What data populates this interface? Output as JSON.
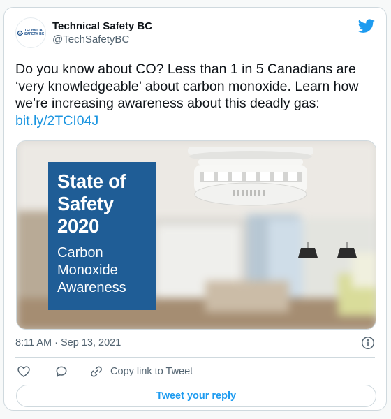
{
  "tweet": {
    "author_name": "Technical Safety BC",
    "author_handle": "@TechSafetyBC",
    "avatar_logo_text": [
      "TECHNICAL",
      "SAFETY BC"
    ],
    "text_lines": [
      "Do you know about CO? Less than 1 in 5 Canadians are",
      "‘very knowledgeable’ about carbon monoxide. Learn how",
      "we’re increasing awareness about this deadly gas:"
    ],
    "link_text": "bit.ly/2TCI04J",
    "timestamp": "8:11 AM · Sep 13, 2021"
  },
  "media": {
    "overlay_title_lines": [
      "State of",
      "Safety",
      "2020"
    ],
    "overlay_subtitle_lines": [
      "Carbon",
      "Monoxide",
      "Awareness"
    ],
    "overlay_color": "#1f5d96",
    "illustration": "smoke-detector-on-ceiling"
  },
  "actions": {
    "like_icon": "heart-icon",
    "reply_icon": "speech-bubble-icon",
    "copy_icon": "link-icon",
    "copy_label": "Copy link to Tweet",
    "reply_button_label": "Tweet your reply"
  },
  "colors": {
    "twitter_blue": "#1d9bf0",
    "link": "#1b95e0",
    "secondary_text": "#536471",
    "border": "#cfd9de"
  }
}
